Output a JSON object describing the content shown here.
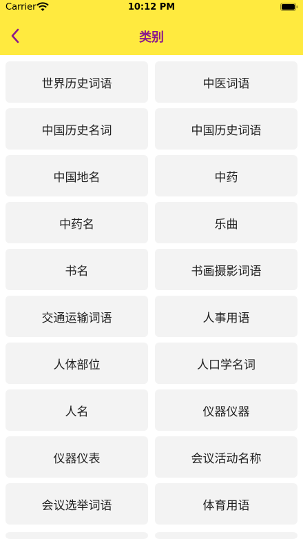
{
  "status_bar": {
    "carrier": "Carrier",
    "time": "10:12 PM"
  },
  "nav": {
    "title": "类别",
    "back_icon": "chevron-left-icon",
    "title_color": "#8B1A8B",
    "background": "#FFEA3F"
  },
  "categories": [
    "世界历史词语",
    "中医词语",
    "中国历史名词",
    "中国历史词语",
    "中国地名",
    "中药",
    "中药名",
    "乐曲",
    "书名",
    "书画摄影词语",
    "交通运输词语",
    "人事用语",
    "人体部位",
    "人口学名词",
    "人名",
    "仪器仪器",
    "仪器仪表",
    "会议活动名称",
    "会议选举词语",
    "体育用语"
  ]
}
